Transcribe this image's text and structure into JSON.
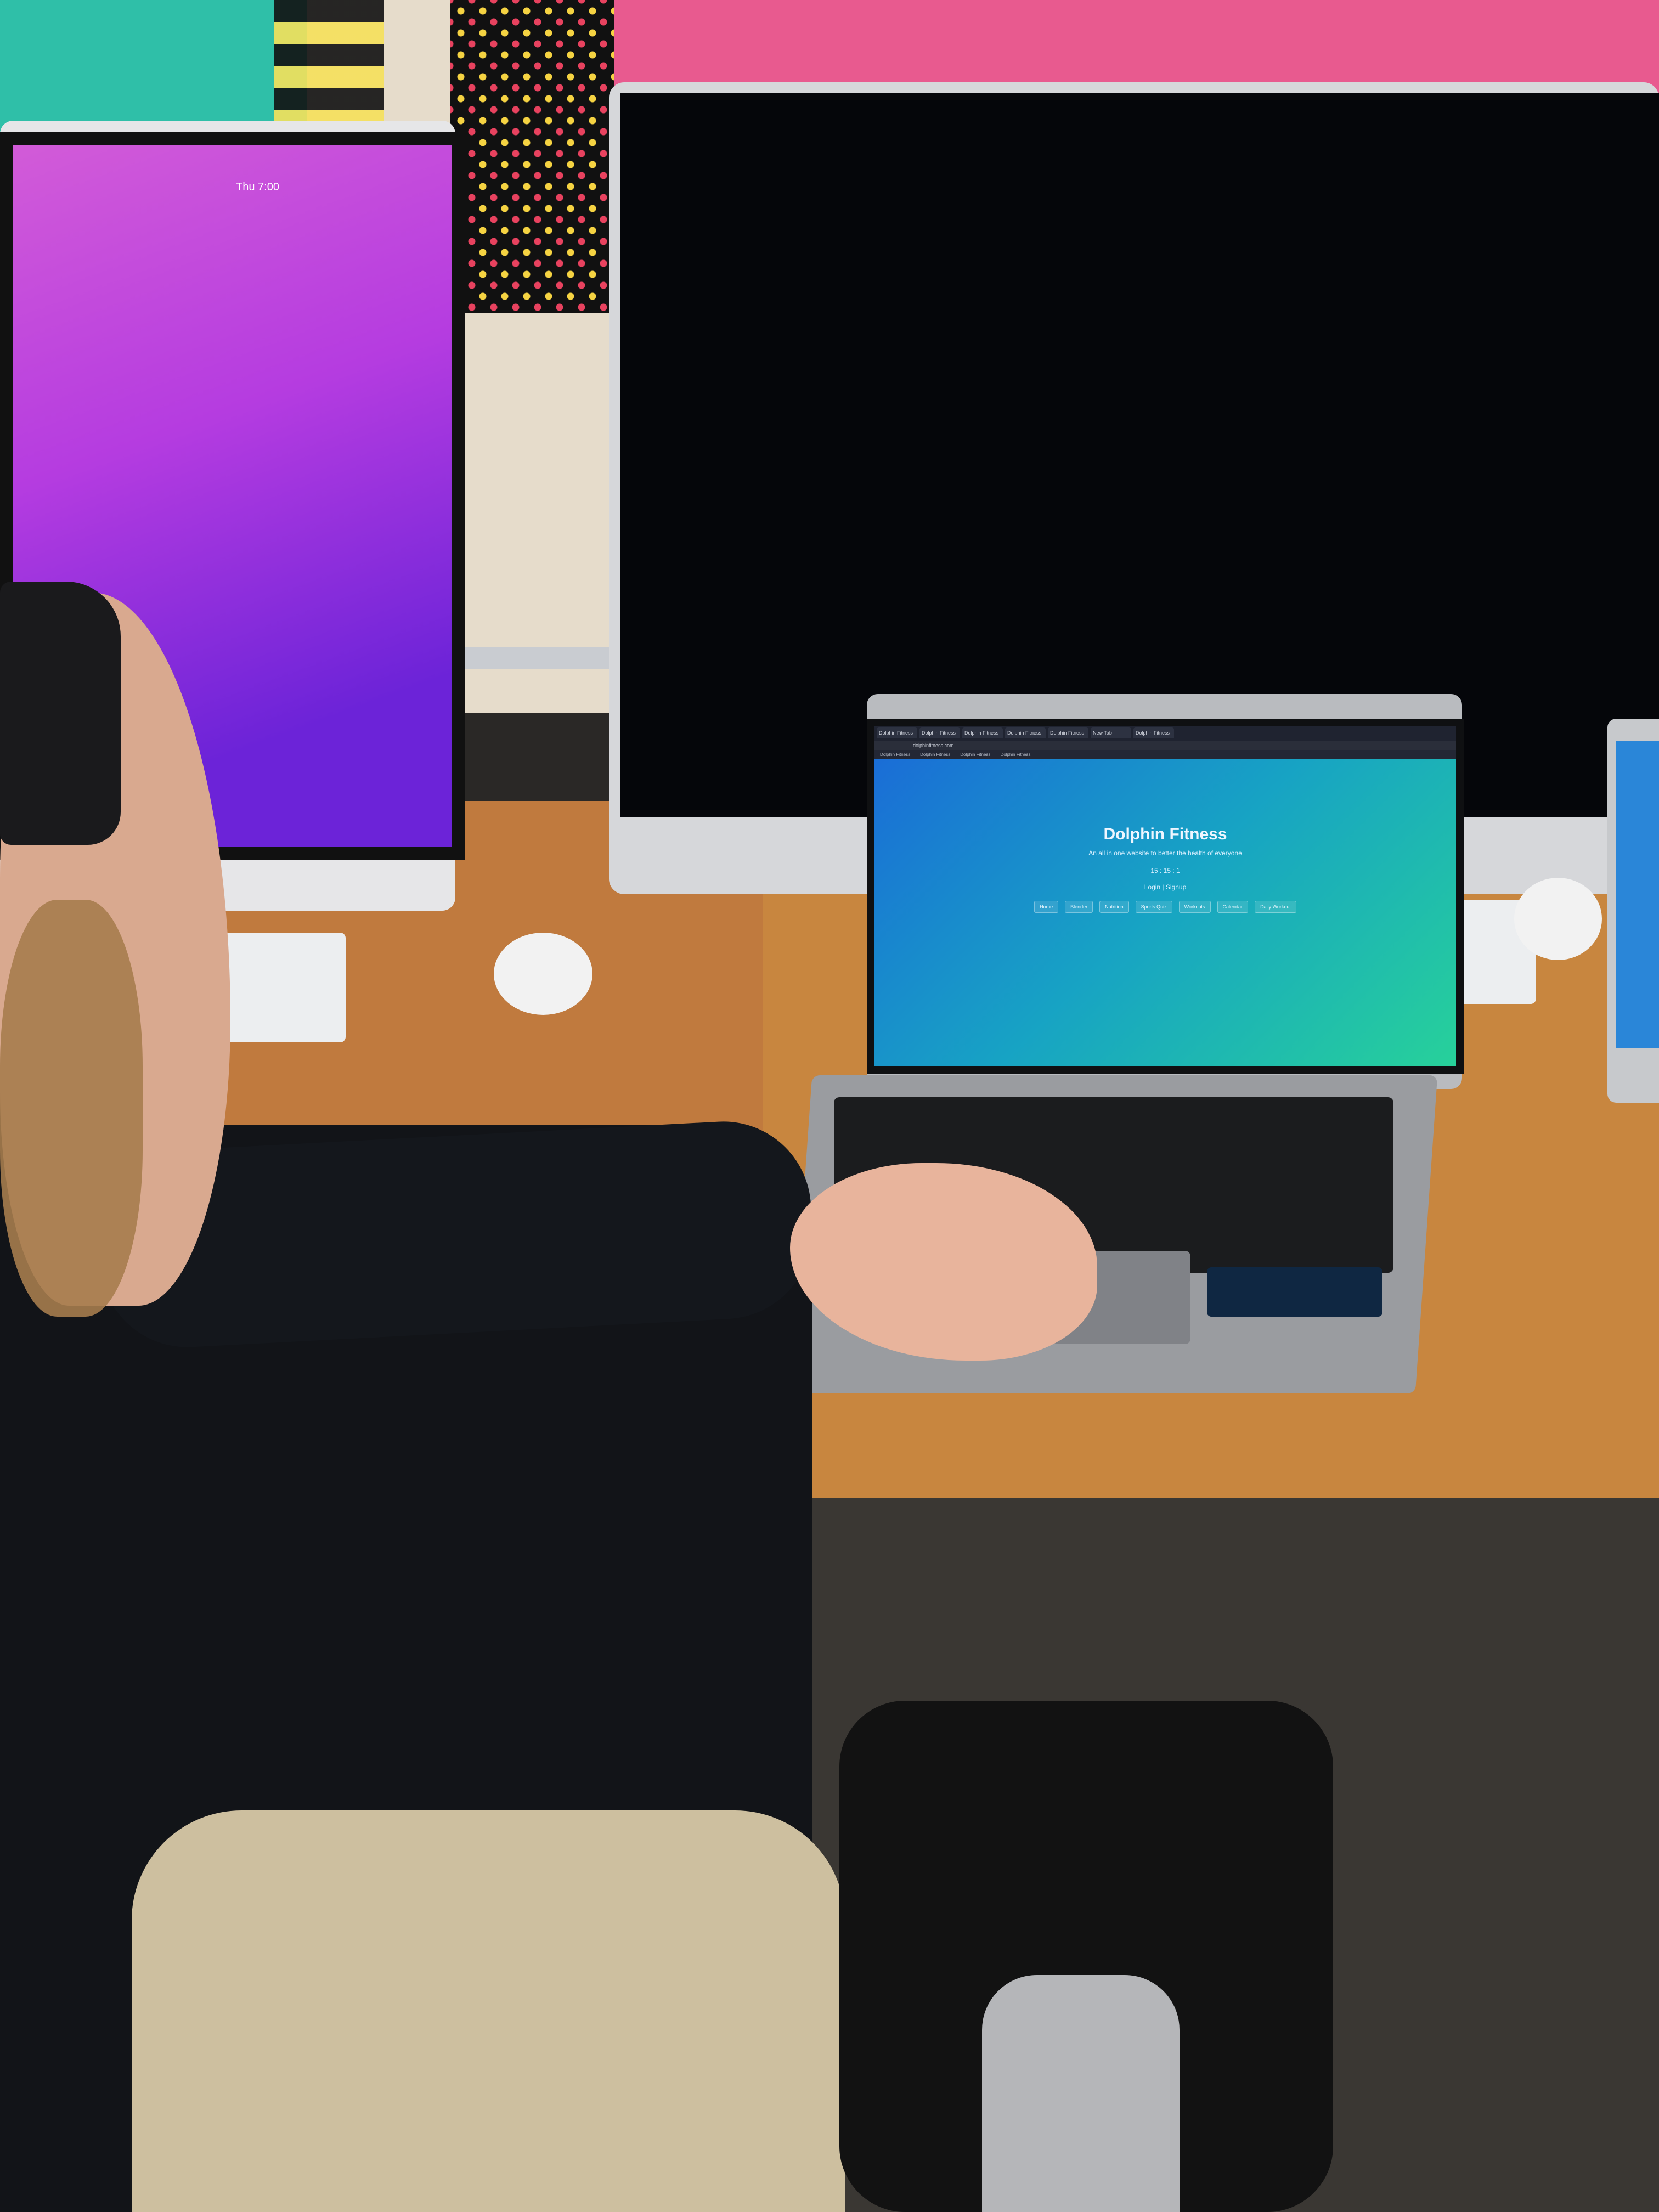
{
  "scene": {
    "left_imac": {
      "menubar_time": "Thu 7:00"
    },
    "laptop": {
      "browser": {
        "tabs": [
          "Dolphin Fitness",
          "Dolphin Fitness",
          "Dolphin Fitness",
          "Dolphin Fitness",
          "Dolphin Fitness",
          "New Tab",
          "Dolphin Fitness"
        ],
        "address": "dolphinfitness.com",
        "bookmarks": [
          "Dolphin Fitness",
          "Dolphin Fitness",
          "Dolphin Fitness",
          "Dolphin Fitness"
        ]
      },
      "website": {
        "title": "Dolphin Fitness",
        "subtitle": "An all in one website to better the health of everyone",
        "timer": "15 : 15 : 1",
        "login": "Login | Signup",
        "nav": [
          "Home",
          "Blender",
          "Nutrition",
          "Sports Quiz",
          "Workouts",
          "Calendar",
          "Daily Workout"
        ]
      }
    }
  },
  "colors": {
    "site_gradient_start": "#1a69d8",
    "site_gradient_end": "#27d19a",
    "wall_pink": "#e85a8f",
    "wall_teal": "#2fbfa8",
    "desk": "#c8863f"
  }
}
